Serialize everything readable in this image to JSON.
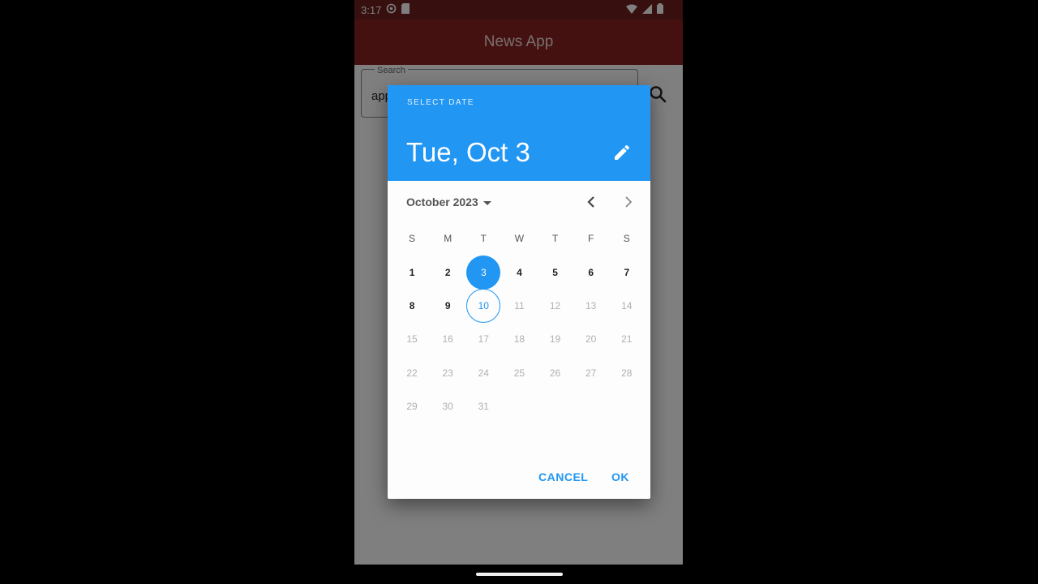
{
  "status_bar": {
    "time": "3:17"
  },
  "app_bar": {
    "title": "News App"
  },
  "search": {
    "label": "Search",
    "value": "app"
  },
  "date_picker": {
    "help_text": "SELECT DATE",
    "header_date": "Tue, Oct 3",
    "month_label": "October 2023",
    "weekdays": [
      "S",
      "M",
      "T",
      "W",
      "T",
      "F",
      "S"
    ],
    "days": [
      "1",
      "2",
      "3",
      "4",
      "5",
      "6",
      "7",
      "8",
      "9",
      "10",
      "11",
      "12",
      "13",
      "14",
      "15",
      "16",
      "17",
      "18",
      "19",
      "20",
      "21",
      "22",
      "23",
      "24",
      "25",
      "26",
      "27",
      "28",
      "29",
      "30",
      "31"
    ],
    "selected_day": "3",
    "today_day": "10",
    "last_enabled_day": "10",
    "cancel_label": "CANCEL",
    "ok_label": "OK",
    "accent_color": "#2196f3"
  },
  "colors": {
    "app_bar": "#8a2020",
    "header": "#2196f3"
  }
}
